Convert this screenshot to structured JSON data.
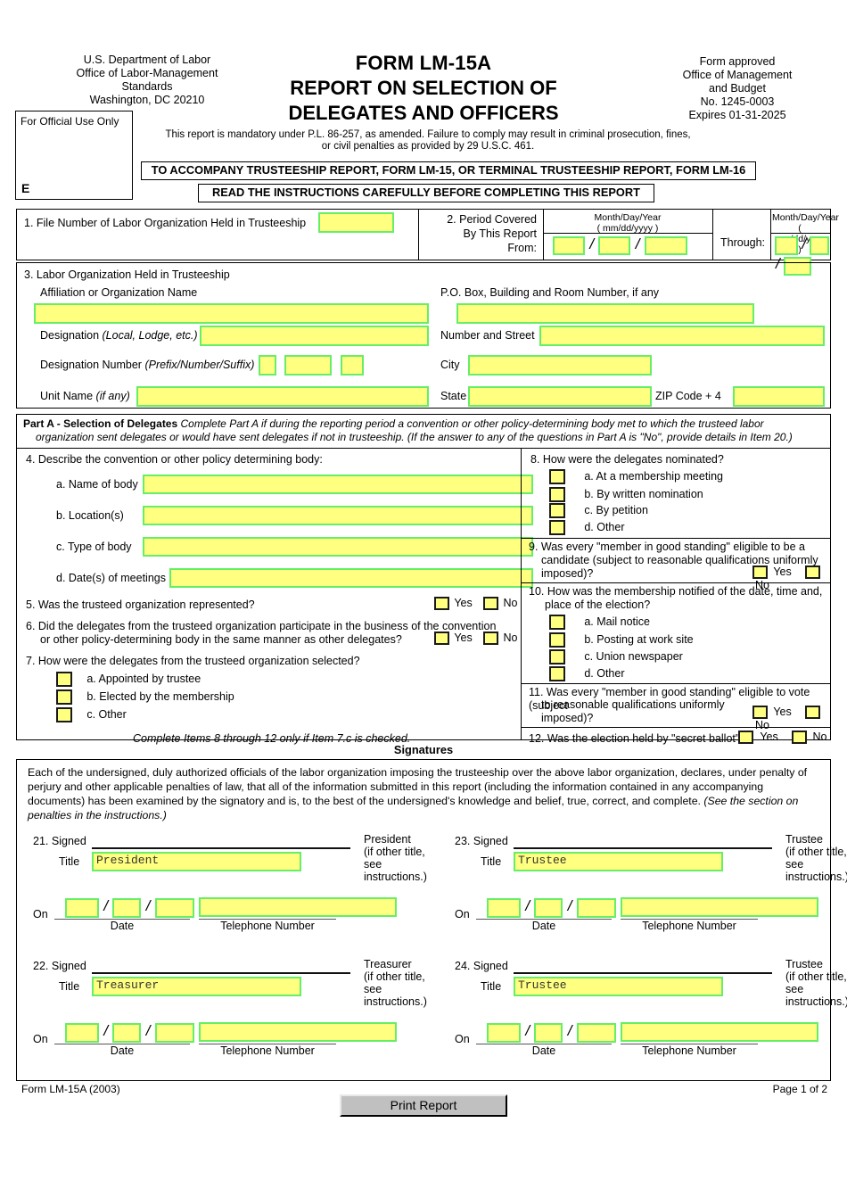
{
  "header": {
    "agency_lines": [
      "U.S. Department of Labor",
      "Office of Labor-Management",
      "Standards",
      "Washington, DC 20210"
    ],
    "official_use_label": "For Official Use Only",
    "official_use_code": "E",
    "title_line1": "FORM LM-15A",
    "title_line2": "REPORT ON SELECTION OF",
    "title_line3": "DELEGATES AND OFFICERS",
    "mandate_line1": "This report is mandatory under P.L. 86-257, as amended. Failure to comply may result in criminal prosecution, fines,",
    "mandate_line2": "or civil penalties as provided by 29 U.S.C. 461.",
    "approval_lines": [
      "Form approved",
      "Office of Management",
      "and Budget",
      "No. 1245-0003",
      "Expires 01-31-2025"
    ],
    "banner_accompany": "TO ACCOMPANY TRUSTEESHIP REPORT, FORM LM-15, OR TERMINAL TRUSTEESHIP REPORT, FORM LM-16",
    "banner_instructions": "READ THE INSTRUCTIONS CAREFULLY BEFORE COMPLETING THIS REPORT"
  },
  "item1": {
    "label": "1. File Number of Labor Organization Held in Trusteeship",
    "value": ""
  },
  "item2": {
    "label_line1": "2. Period Covered",
    "label_line2": "By This Report",
    "label_line3": "From:",
    "mdy_line1": "Month/Day/Year",
    "mdy_line2": "( mm/dd/yyyy )",
    "through_label": "Through:",
    "from_month": "",
    "from_day": "",
    "from_year": "",
    "through_month": "",
    "through_day": "",
    "through_year": ""
  },
  "item3": {
    "heading": "3. Labor Organization Held in Trusteeship",
    "affiliation_label": "Affiliation or Organization Name",
    "affiliation_value": "",
    "designation_label": "Designation",
    "designation_label_italic": "(Local, Lodge, etc.)",
    "designation_value": "",
    "designation_number_label": "Designation Number",
    "designation_number_label_italic": "(Prefix/Number/Suffix)",
    "designation_prefix": "",
    "designation_number": "",
    "designation_suffix": "",
    "unit_name_label": "Unit Name",
    "unit_name_label_italic": "(if any)",
    "unit_name_value": "",
    "pobox_label": "P.O. Box, Building and Room Number, if any",
    "pobox_value": "",
    "street_label": "Number and Street",
    "street_value": "",
    "city_label": "City",
    "city_value": "",
    "state_label": "State",
    "state_value": "",
    "zip_label": "ZIP Code + 4",
    "zip_value": ""
  },
  "partA": {
    "title": "Part A - Selection of Delegates",
    "instructions_line1": "Complete Part A if during the reporting period a convention or other policy-determining body met to which the trusteed labor",
    "instructions_line2": "organization sent delegates or would have sent delegates if not in trusteeship. (If the answer to any of the questions in Part A is \"No\", provide details in Item 20.)",
    "item4": {
      "label": "4. Describe the convention or other policy determining body:",
      "a_label": "a. Name of body",
      "a_value": "",
      "b_label": "b. Location(s)",
      "b_value": "",
      "c_label": "c. Type of body",
      "c_value": "",
      "d_label": "d. Date(s) of meetings",
      "d_value": ""
    },
    "item5": {
      "label": "5. Was the trusteed organization represented?",
      "yes_label": "Yes",
      "no_label": "No"
    },
    "item6": {
      "label_line1": "6. Did the delegates from the trusteed organization participate in the business of the convention",
      "label_line2": "or other policy-determining body in the same manner as other delegates?",
      "yes_label": "Yes",
      "no_label": "No"
    },
    "item7": {
      "label": "7. How were the delegates from the trusteed organization selected?",
      "a_label": "a. Appointed by trustee",
      "b_label": "b. Elected by the membership",
      "c_label": "c. Other",
      "note": "Complete Items 8 through 12 only if Item 7.c is checked."
    },
    "item8": {
      "label": "8. How were the delegates nominated?",
      "a_label": "a. At a membership meeting",
      "b_label": "b. By written nomination",
      "c_label": "c.  By petition",
      "d_label": "d. Other"
    },
    "item9": {
      "label_line1": "9. Was every \"member in good standing\" eligible to be a",
      "label_line2": "candidate (subject to reasonable qualifications uniformly",
      "label_line3": "imposed)?",
      "yes_label": "Yes",
      "no_label": "No"
    },
    "item10": {
      "label_line1": "10. How was the membership notified of the date, time and,",
      "label_line2": "place of the election?",
      "a_label": "a. Mail notice",
      "b_label": "b. Posting at work site",
      "c_label": "c.  Union newspaper",
      "d_label": "d. Other"
    },
    "item11": {
      "label_line1": "11. Was every \"member in good standing\" eligible to vote (subject",
      "label_line2": "to reasonable qualifications uniformly",
      "label_line3": "imposed)?",
      "yes_label": "Yes",
      "no_label": "No"
    },
    "item12": {
      "label": "12. Was the election held by \"secret ballot\"?",
      "yes_label": "Yes",
      "no_label": "No"
    }
  },
  "signatures": {
    "heading": "Signatures",
    "declaration_line1": "Each of the undersigned, duly authorized officials of the labor organization imposing the trusteeship over the above labor organization, declares, under penalty",
    "declaration_line2": "of perjury and other applicable penalties of law, that all of the information submitted in this report (including the information contained in any accompanying",
    "declaration_line3": "documents) has been examined by the signatory and is, to the best of the undersigned's knowledge and belief, true, correct, and complete.",
    "declaration_italic": "(See the section on penalties in the instructions.)",
    "signed_label": "Signed",
    "title_label": "Title",
    "on_label": "On",
    "date_label": "Date",
    "telephone_label": "Telephone Number",
    "other_title_line1": "(if other title,",
    "other_title_line2": "see instructions.)",
    "blocks": [
      {
        "num": "21.",
        "role": "President",
        "title_value": "President",
        "month": "",
        "day": "",
        "year": "",
        "telephone": ""
      },
      {
        "num": "22.",
        "role": "Treasurer",
        "title_value": "Treasurer",
        "month": "",
        "day": "",
        "year": "",
        "telephone": ""
      },
      {
        "num": "23.",
        "role": "Trustee",
        "title_value": "Trustee",
        "month": "",
        "day": "",
        "year": "",
        "telephone": ""
      },
      {
        "num": "24.",
        "role": "Trustee",
        "title_value": "Trustee",
        "month": "",
        "day": "",
        "year": "",
        "telephone": ""
      }
    ]
  },
  "footer": {
    "form_id": "Form LM-15A (2003)",
    "page": "Page 1 of 2",
    "print_button": "Print Report"
  },
  "colors": {
    "field_fill": "#ffff80",
    "field_border": "#66ee66",
    "checkbox_border": "#1a1a1a",
    "button_face": "#c0c0c0"
  }
}
